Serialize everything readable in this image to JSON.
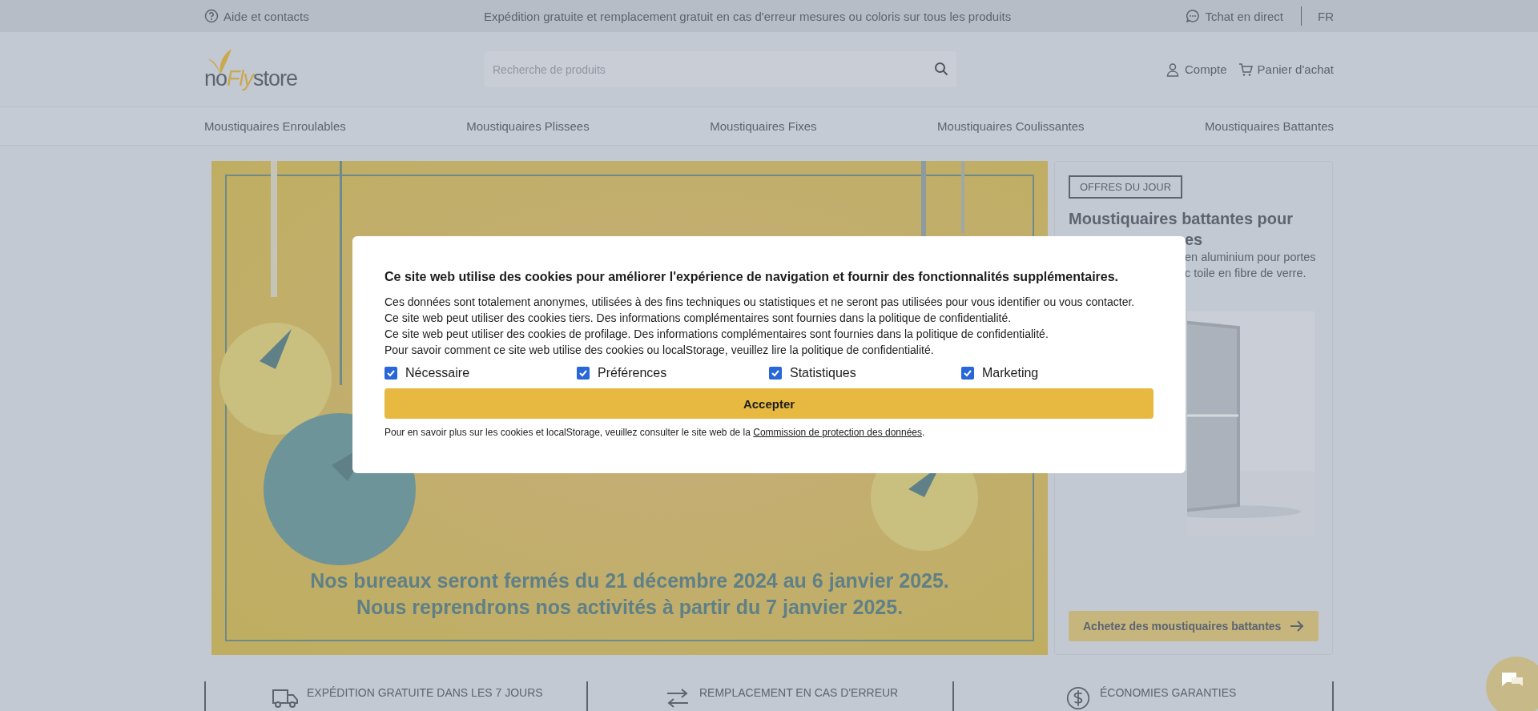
{
  "top_bar": {
    "help": "Aide et contacts",
    "promo": "Expédition gratuite et remplacement gratuit en cas d'erreur mesures ou coloris sur tous les produits",
    "chat": "Tchat en direct",
    "language": "FR"
  },
  "header": {
    "logo": [
      "no",
      "Fly",
      "store"
    ],
    "search": {
      "placeholder": "Recherche de produits"
    },
    "account": "Compte",
    "cart": "Panier d'achat"
  },
  "nav": [
    "Moustiquaires Enroulables",
    "Moustiquaires Plissees",
    "Moustiquaires Fixes",
    "Moustiquaires Coulissantes",
    "Moustiquaires Battantes"
  ],
  "banner": {
    "kind": "picture",
    "lines": [
      "Nos bureaux seront fermés du 21 décembre 2024 au 6 janvier 2025.",
      "Nous reprendrons nos activités à partir du 7 janvier 2025."
    ]
  },
  "offer_card": {
    "badge": "OFFRES DU JOUR",
    "title": "Moustiquaires battantes pour",
    "title_end": "es",
    "description": [
      "en aluminium pour portes",
      "c toile en fibre de verre."
    ],
    "button": "Achetez des moustiquaires battantes"
  },
  "features": [
    {
      "kind": "truck",
      "label": "EXPÉDITION GRATUITE DANS LES 7 JOURS"
    },
    {
      "kind": "arrows",
      "label": "REMPLACEMENT EN CAS D'ERREUR"
    },
    {
      "kind": "dollar",
      "label": "ÉCONOMIES GARANTIES"
    }
  ],
  "cookie_dialog": {
    "title": "Ce site web utilise des cookies pour améliorer l'expérience de navigation et fournir des fonctionnalités supplémentaires.",
    "paragraphs": [
      "Ces données sont totalement anonymes, utilisées à des fins techniques ou statistiques et ne seront pas utilisées pour vous identifier ou vous contacter.",
      "Ce site web peut utiliser des cookies tiers. Des informations complémentaires sont fournies dans la politique de confidentialité.",
      "Ce site web peut utiliser des cookies de profilage. Des informations complémentaires sont fournies dans la politique de confidentialité.",
      "Pour savoir comment ce site web utilise des cookies ou localStorage, veuillez lire la politique de confidentialité."
    ],
    "options": [
      {
        "label": "Nécessaire",
        "checked": true
      },
      {
        "label": "Préférences",
        "checked": true
      },
      {
        "label": "Statistiques",
        "checked": true
      },
      {
        "label": "Marketing",
        "checked": true
      }
    ],
    "accept_button": "Accepter",
    "footer": "Pour en savoir plus sur les cookies et localStorage, veuillez consulter le site web de la ",
    "footer_link": "Commission de protection des données",
    "footer_end": "."
  }
}
